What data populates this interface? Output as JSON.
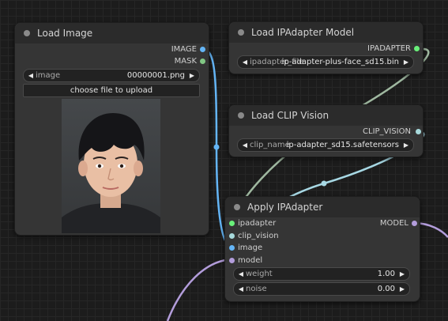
{
  "nodes": {
    "load_image": {
      "title": "Load Image",
      "outputs": {
        "image": "IMAGE",
        "mask": "MASK"
      },
      "widget": {
        "name": "image",
        "value": "00000001.png"
      },
      "upload_button": "choose file to upload"
    },
    "load_ipadapter_model": {
      "title": "Load IPAdapter Model",
      "output": "IPADAPTER",
      "widget": {
        "name": "ipadapter_file",
        "value": "ip-adapter-plus-face_sd15.bin"
      }
    },
    "load_clip_vision": {
      "title": "Load CLIP Vision",
      "output": "CLIP_VISION",
      "widget": {
        "name": "clip_name",
        "value": "ip-adapter_sd15.safetensors"
      }
    },
    "apply_ipadapter": {
      "title": "Apply IPAdapter",
      "inputs": [
        "ipadapter",
        "clip_vision",
        "image",
        "model"
      ],
      "output": "MODEL",
      "widgets": [
        {
          "name": "weight",
          "value": "1.00"
        },
        {
          "name": "noise",
          "value": "0.00"
        }
      ]
    }
  },
  "colors": {
    "ipadapter_link": "#9fb8a0",
    "clip_vision_link": "#a7d8e4",
    "image_link": "#64b5f6",
    "model_link": "#b39ddb",
    "ipadapter_dot": "#69f07a",
    "clip_vision_dot": "#a8dadc",
    "image_dot": "#64b5f6",
    "mask_dot": "#81c784",
    "model_dot": "#b39ddb"
  }
}
